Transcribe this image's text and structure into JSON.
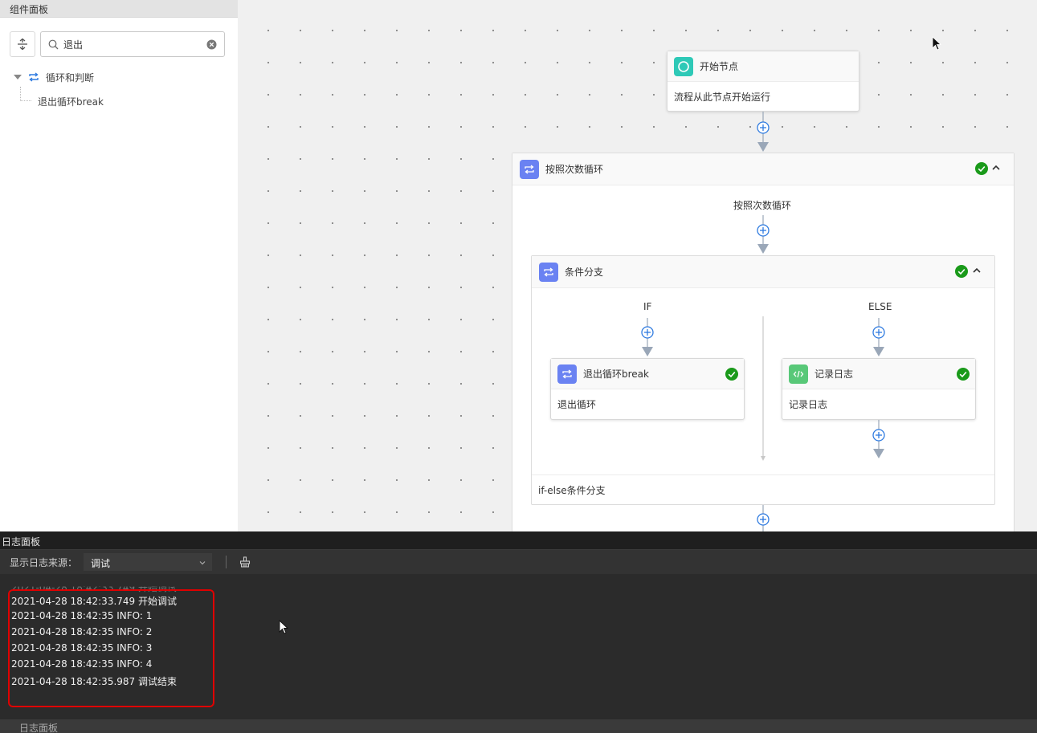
{
  "left_panel": {
    "title": "组件面板",
    "search": {
      "value": "退出",
      "placeholder": ""
    },
    "tree": {
      "group_label": "循环和判断",
      "leaf_label": "退出循环break"
    }
  },
  "canvas": {
    "start_node": {
      "title": "开始节点",
      "body": "流程从此节点开始运行"
    },
    "loop": {
      "title": "按照次数循环",
      "inner_label": "按照次数循环"
    },
    "branch": {
      "title": "条件分支",
      "if_label": "IF",
      "else_label": "ELSE",
      "footer": "if-else条件分支"
    },
    "break_node": {
      "title": "退出循环break",
      "body": "退出循环"
    },
    "log_node": {
      "title": "记录日志",
      "body": "记录日志"
    }
  },
  "log_panel": {
    "title": "日志面板",
    "source_label": "显示日志来源：",
    "source_value": "调试",
    "faded_line": "2021-04-28 18:42:33.749 开始调试",
    "lines": [
      "2021-04-28 18:42:33.749 开始调试",
      "2021-04-28 18:42:35 INFO: 1",
      "2021-04-28 18:42:35 INFO: 2",
      "2021-04-28 18:42:35 INFO: 3",
      "2021-04-28 18:42:35 INFO: 4",
      "2021-04-28 18:42:35.987 调试结束"
    ],
    "footer_tab": "日志面板"
  },
  "colors": {
    "accent_blue": "#2f7be0",
    "loop_icon": "#6a82f2",
    "start_icon": "#2ec9b7",
    "log_icon": "#58c878",
    "success": "#1a9a1a",
    "highlight": "#e00000"
  }
}
